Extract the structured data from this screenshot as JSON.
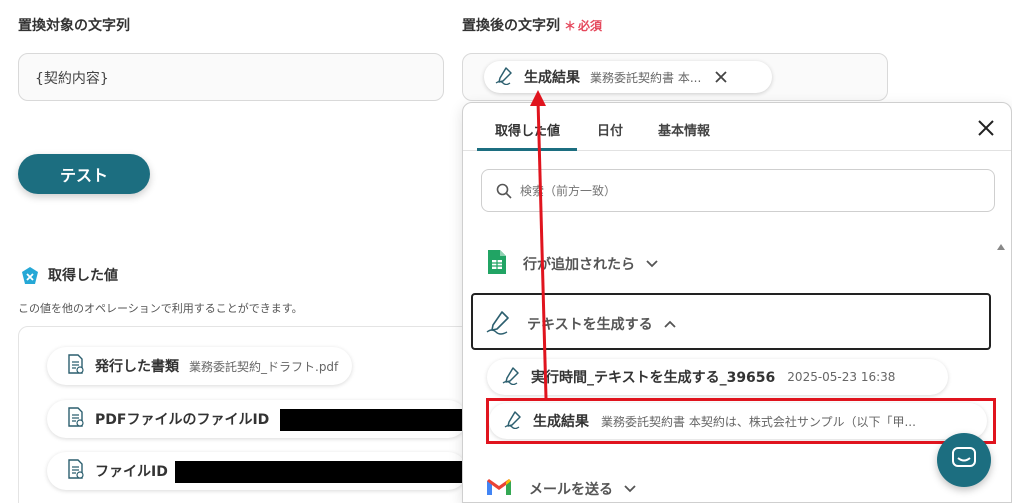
{
  "left_field": {
    "label": "置換対象の文字列",
    "value": "{契約内容}"
  },
  "right_field": {
    "label": "置換後の文字列",
    "required_mark": "＊",
    "required_text": "必須",
    "chip": {
      "title": "生成結果",
      "value": "業務委託契約書 本..."
    }
  },
  "test_button": {
    "label": "テスト"
  },
  "obtained_section": {
    "title": "取得した値",
    "description": "この値を他のオペレーションで利用することができます。",
    "items": [
      {
        "title": "発行した書類",
        "value": "業務委託契約_ドラフト.pdf"
      },
      {
        "title": "PDFファイルのファイルID",
        "value": ""
      },
      {
        "title": "ファイルID",
        "value": ""
      }
    ]
  },
  "picker": {
    "tabs": [
      "取得した値",
      "日付",
      "基本情報"
    ],
    "active_tab": "取得した値",
    "search_placeholder": "検索（前方一致）",
    "groups": [
      {
        "label": "行が追加されたら",
        "icon": "google-sheets-icon",
        "expanded": false
      },
      {
        "label": "テキストを生成する",
        "icon": "ai-pen-icon",
        "expanded": true
      },
      {
        "label": "メールを送る",
        "icon": "gmail-icon",
        "expanded": false
      }
    ],
    "generate_items": [
      {
        "title": "実行時間_テキストを生成する_39656",
        "value": "2025-05-23 16:38"
      },
      {
        "title": "生成結果",
        "value": "業務委託契約書 本契約は、株式会社サンプル（以下「甲..."
      }
    ]
  },
  "colors": {
    "accent": "#1c6e80",
    "required": "#e5485c",
    "highlight": "#e0141e"
  }
}
